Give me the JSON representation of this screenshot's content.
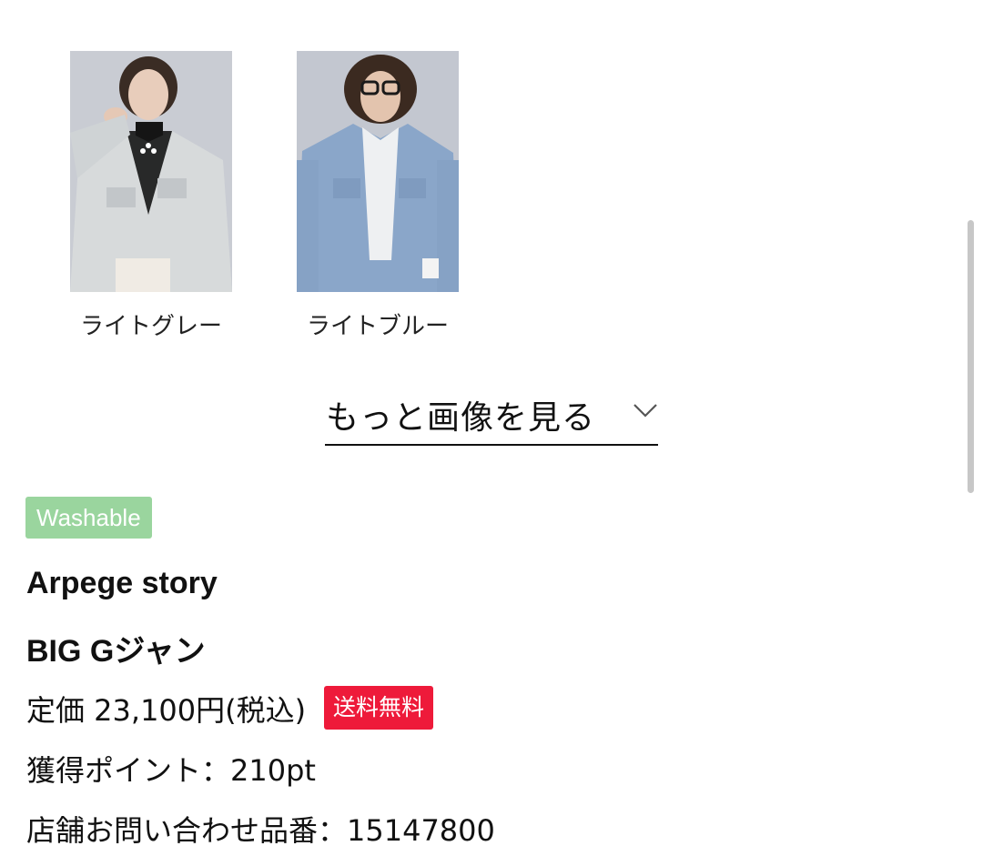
{
  "swatches": [
    {
      "label": "ライトグレー",
      "image": "light-gray-denim-jacket-photo",
      "color": "#d5d9dc"
    },
    {
      "label": "ライトブルー",
      "image": "light-blue-denim-jacket-photo",
      "color": "#8fa8c6"
    }
  ],
  "more_images": {
    "label": "もっと画像を見る",
    "icon": "chevron-down-icon"
  },
  "badge": {
    "label": "Washable",
    "color": "#9ad59e"
  },
  "product": {
    "brand": "Arpege story",
    "name": "BIG Gジャン",
    "price": "定価 23,100円(税込)",
    "shipping_badge": "送料無料",
    "shipping_badge_color": "#ee1a3a",
    "points": "獲得ポイント：210pt",
    "store_number": "店舗お問い合わせ品番：15147800"
  }
}
